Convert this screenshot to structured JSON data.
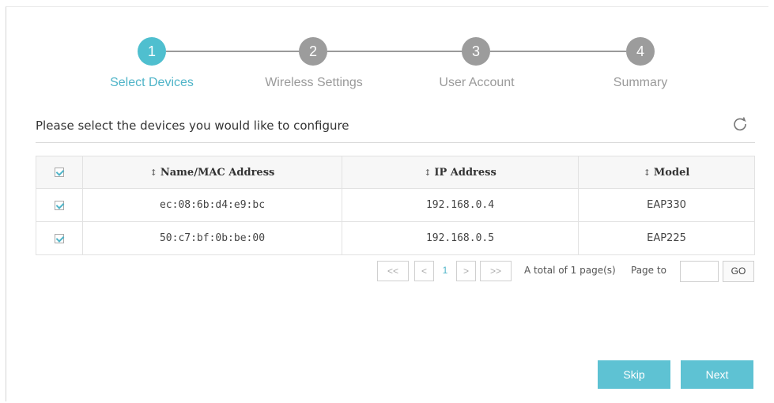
{
  "stepper": {
    "steps": [
      {
        "number": "1",
        "label": "Select Devices",
        "active": true
      },
      {
        "number": "2",
        "label": "Wireless Settings",
        "active": false
      },
      {
        "number": "3",
        "label": "User Account",
        "active": false
      },
      {
        "number": "4",
        "label": "Summary",
        "active": false
      }
    ]
  },
  "instruction": "Please select the devices you would like to configure",
  "table": {
    "columns": [
      "Name/MAC Address",
      "IP Address",
      "Model"
    ],
    "sort_glyph": "↕",
    "rows": [
      {
        "name": "ec:08:6b:d4:e9:bc",
        "ip": "192.168.0.4",
        "model": "EAP330",
        "checked": true
      },
      {
        "name": "50:c7:bf:0b:be:00",
        "ip": "192.168.0.5",
        "model": "EAP225",
        "checked": true
      }
    ]
  },
  "pagination": {
    "first": "<<",
    "prev": "<",
    "current": "1",
    "next": ">",
    "last": ">>",
    "total_text": "A total of 1 page(s)",
    "page_to_label": "Page to",
    "go_label": "GO"
  },
  "footer": {
    "skip_label": "Skip",
    "next_label": "Next"
  },
  "colors": {
    "accent": "#4fb4c8",
    "button": "#5ec2d3",
    "inactive_step": "#9c9c9c"
  }
}
